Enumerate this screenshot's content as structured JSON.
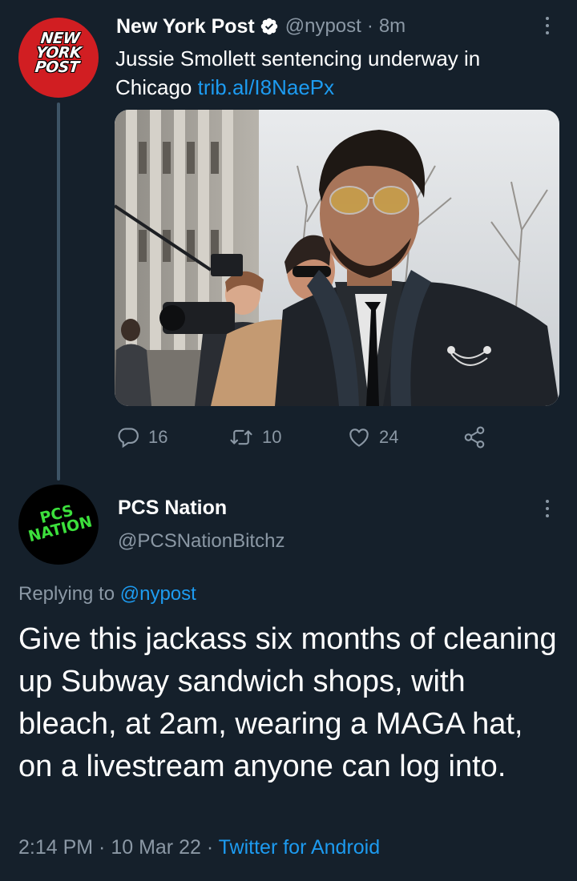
{
  "parent_tweet": {
    "avatar_text": [
      "NEW",
      "YORK",
      "POST"
    ],
    "display_name": "New York Post",
    "handle": "@nypost",
    "separator": "·",
    "time": "8m",
    "text": "Jussie Smollett sentencing underway in Chicago ",
    "link": "trib.al/I8NaePx",
    "image_description": "photo-jussie-smollett",
    "stats": {
      "replies": "16",
      "retweets": "10",
      "likes": "24"
    }
  },
  "reply_tweet": {
    "avatar_text": [
      "PCS",
      "NATION"
    ],
    "display_name": "PCS Nation",
    "handle": "@PCSNationBitchz",
    "replying_prefix": "Replying to ",
    "replying_handle": "@nypost",
    "text": "Give this jackass six months of cleaning up Subway sandwich shops, with bleach, at 2am, wearing a MAGA hat, on a livestream anyone can log into.",
    "time": "2:14 PM",
    "separator": " · ",
    "date": "10 Mar 22",
    "source": "Twitter for Android"
  },
  "colors": {
    "background": "#15202b",
    "text_primary": "#ffffff",
    "text_secondary": "#8b98a5",
    "link": "#1d9bf0",
    "thread_line": "#3d5466",
    "nypost_red": "#d11e22",
    "pcs_green": "#3ce03c"
  },
  "icons": [
    "verified-badge-icon",
    "more-options-icon",
    "reply-icon",
    "retweet-icon",
    "like-icon",
    "share-icon"
  ]
}
